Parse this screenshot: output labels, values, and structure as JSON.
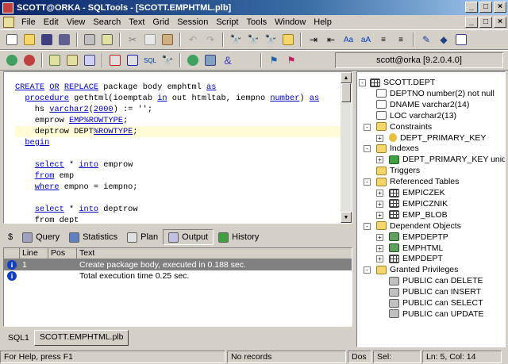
{
  "window": {
    "title": "SCOTT@ORKA - SQLTools - [SCOTT.EMPHTML.plb]",
    "min": "_",
    "max": "□",
    "close": "×"
  },
  "menu": [
    "File",
    "Edit",
    "View",
    "Search",
    "Text",
    "Grid",
    "Session",
    "Script",
    "Tools",
    "Window",
    "Help"
  ],
  "connection": "scott@orka [9.2.0.4.0]",
  "editor": {
    "lines": [
      {
        "segs": [
          [
            "kw",
            "CREATE"
          ],
          [
            "t",
            " "
          ],
          [
            "kw",
            "OR"
          ],
          [
            "t",
            " "
          ],
          [
            "kw",
            "REPLACE"
          ],
          [
            "t",
            " package body emphtml "
          ],
          [
            "kw",
            "as"
          ]
        ]
      },
      {
        "segs": [
          [
            "t",
            "  "
          ],
          [
            "kw",
            "procedure"
          ],
          [
            "t",
            " gethtml(ioemptab "
          ],
          [
            "kw",
            "in"
          ],
          [
            "t",
            " out htmltab, iempno "
          ],
          [
            "kw",
            "number"
          ],
          [
            "t",
            ") "
          ],
          [
            "kw",
            "as"
          ]
        ]
      },
      {
        "segs": [
          [
            "t",
            "    hs "
          ],
          [
            "kw",
            "varchar2"
          ],
          [
            "t",
            "("
          ],
          [
            "kw",
            "2000"
          ],
          [
            "t",
            ") := '';"
          ]
        ]
      },
      {
        "segs": [
          [
            "t",
            "    emprow "
          ],
          [
            "kw",
            "EMP%ROWTYPE"
          ],
          [
            "t",
            ";"
          ]
        ]
      },
      {
        "segs": [
          [
            "t",
            "    deptrow DEPT"
          ],
          [
            "kw",
            "%ROWTYPE"
          ],
          [
            "t",
            ";"
          ]
        ],
        "current": true
      },
      {
        "segs": [
          [
            "t",
            "  "
          ],
          [
            "kw",
            "begin"
          ]
        ]
      },
      {
        "segs": [
          [
            "t",
            ""
          ]
        ]
      },
      {
        "segs": [
          [
            "t",
            "    "
          ],
          [
            "kw",
            "select"
          ],
          [
            "t",
            " * "
          ],
          [
            "kw",
            "into"
          ],
          [
            "t",
            " emprow"
          ]
        ]
      },
      {
        "segs": [
          [
            "t",
            "    "
          ],
          [
            "kw",
            "from"
          ],
          [
            "t",
            " emp"
          ]
        ]
      },
      {
        "segs": [
          [
            "t",
            "    "
          ],
          [
            "kw",
            "where"
          ],
          [
            "t",
            " empno = iempno;"
          ]
        ]
      },
      {
        "segs": [
          [
            "t",
            ""
          ]
        ]
      },
      {
        "segs": [
          [
            "t",
            "    "
          ],
          [
            "kw",
            "select"
          ],
          [
            "t",
            " * "
          ],
          [
            "kw",
            "into"
          ],
          [
            "t",
            " deptrow"
          ]
        ]
      },
      {
        "segs": [
          [
            "t",
            "    from dept"
          ]
        ]
      }
    ]
  },
  "bottom_tabs": [
    {
      "label": "$",
      "name": "tab-dollar"
    },
    {
      "label": "Query",
      "name": "tab-query"
    },
    {
      "label": "Statistics",
      "name": "tab-statistics"
    },
    {
      "label": "Plan",
      "name": "tab-plan"
    },
    {
      "label": "Output",
      "name": "tab-output",
      "active": true
    },
    {
      "label": "History",
      "name": "tab-history"
    }
  ],
  "output": {
    "headers": [
      "Line",
      "Pos",
      "Text"
    ],
    "rows": [
      {
        "line": "1",
        "pos": "",
        "text": "Create package body, executed in 0.188 sec.",
        "selected": true
      },
      {
        "line": "",
        "pos": "",
        "text": "Total execution time 0.25 sec."
      }
    ]
  },
  "doc_tabs": [
    {
      "label": "SQL1"
    },
    {
      "label": "SCOTT.EMPHTML.plb",
      "active": true
    }
  ],
  "tree": [
    {
      "label": "SCOTT.DEPT",
      "level": 0,
      "icon": "table",
      "exp": "-"
    },
    {
      "label": "DEPTNO   number(2)   not null",
      "level": 1,
      "icon": "col"
    },
    {
      "label": "DNAME   varchar2(14)",
      "level": 1,
      "icon": "col"
    },
    {
      "label": "LOC   varchar2(13)",
      "level": 1,
      "icon": "col"
    },
    {
      "label": "Constraints",
      "level": 1,
      "icon": "folder",
      "exp": "-"
    },
    {
      "label": "DEPT_PRIMARY_KEY",
      "level": 2,
      "icon": "key",
      "exp": "+"
    },
    {
      "label": "Indexes",
      "level": 1,
      "icon": "folder",
      "exp": "-"
    },
    {
      "label": "DEPT_PRIMARY_KEY   unique",
      "level": 2,
      "icon": "idx",
      "exp": "+"
    },
    {
      "label": "Triggers",
      "level": 1,
      "icon": "folder"
    },
    {
      "label": "Referenced Tables",
      "level": 1,
      "icon": "folder",
      "exp": "-"
    },
    {
      "label": "EMPICZEK",
      "level": 2,
      "icon": "table",
      "exp": "+"
    },
    {
      "label": "EMPICZNIK",
      "level": 2,
      "icon": "table",
      "exp": "+"
    },
    {
      "label": "EMP_BLOB",
      "level": 2,
      "icon": "table",
      "exp": "+"
    },
    {
      "label": "Dependent Objects",
      "level": 1,
      "icon": "folder",
      "exp": "-"
    },
    {
      "label": "EMPDEPTP",
      "level": 2,
      "icon": "pkg",
      "exp": "+"
    },
    {
      "label": "EMPHTML",
      "level": 2,
      "icon": "pkg",
      "exp": "+"
    },
    {
      "label": "EMPDEPT",
      "level": 2,
      "icon": "table",
      "exp": "+"
    },
    {
      "label": "Granted Privileges",
      "level": 1,
      "icon": "folder",
      "exp": "-"
    },
    {
      "label": "PUBLIC can DELETE",
      "level": 2,
      "icon": "priv"
    },
    {
      "label": "PUBLIC can INSERT",
      "level": 2,
      "icon": "priv"
    },
    {
      "label": "PUBLIC can SELECT",
      "level": 2,
      "icon": "priv"
    },
    {
      "label": "PUBLIC can UPDATE",
      "level": 2,
      "icon": "priv"
    }
  ],
  "status": {
    "help": "For Help, press F1",
    "records": "No records",
    "mode": "Dos",
    "selection": "Sel: Stream",
    "position": "Ln: 5, Col: 14"
  },
  "colors": {
    "keyword": "#0000c0",
    "title_start": "#0a246a",
    "title_end": "#a6caf0",
    "selected_row": "#808080"
  }
}
